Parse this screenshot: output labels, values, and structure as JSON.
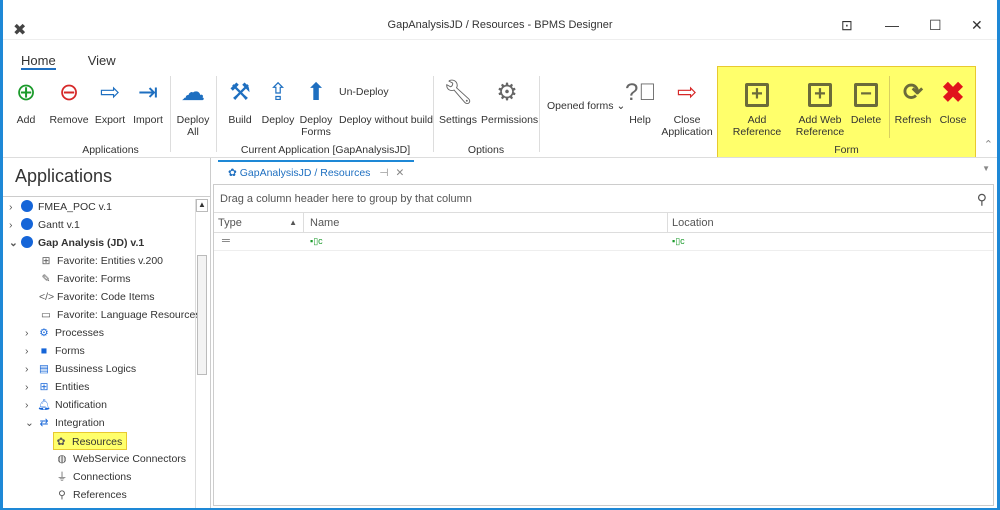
{
  "window": {
    "title": "GapAnalysisJD / Resources - BPMS Designer"
  },
  "ribbon": {
    "tabs": [
      "Home",
      "View"
    ],
    "buttons": {
      "add": "Add",
      "remove": "Remove",
      "export": "Export",
      "import": "Import",
      "deploy_all": "Deploy All",
      "build": "Build",
      "deploy": "Deploy",
      "deploy_forms": "Deploy Forms",
      "undeploy": "Un-Deploy",
      "deploy_without_build": "Deploy without build",
      "settings": "Settings",
      "permissions": "Permissions",
      "opened_forms": "Opened forms",
      "help": "Help",
      "close_application": "Close Application",
      "add_reference": "Add Reference",
      "add_web_reference": "Add Web Reference",
      "delete": "Delete",
      "refresh": "Refresh",
      "close": "Close"
    },
    "groups": {
      "applications": "Applications",
      "current_app": "Current Application [GapAnalysisJD]",
      "options": "Options",
      "form": "Form"
    }
  },
  "left": {
    "title": "Applications",
    "tree": [
      {
        "label": "FMEA_POC v.1"
      },
      {
        "label": "Gantt v.1"
      },
      {
        "label": "Gap Analysis (JD) v.1"
      },
      {
        "label": "Favorite: Entities v.200"
      },
      {
        "label": "Favorite: Forms"
      },
      {
        "label": "Favorite: Code Items"
      },
      {
        "label": "Favorite: Language Resources"
      },
      {
        "label": "Processes"
      },
      {
        "label": "Forms"
      },
      {
        "label": "Bussiness Logics"
      },
      {
        "label": "Entities"
      },
      {
        "label": "Notification"
      },
      {
        "label": "Integration"
      },
      {
        "label": "Resources"
      },
      {
        "label": "WebService Connectors"
      },
      {
        "label": "Connections"
      },
      {
        "label": "References"
      }
    ]
  },
  "main": {
    "tab": "GapAnalysisJD / Resources",
    "group_hint": "Drag a column header here to group by that column",
    "columns": [
      "Type",
      "Name",
      "Location"
    ]
  }
}
